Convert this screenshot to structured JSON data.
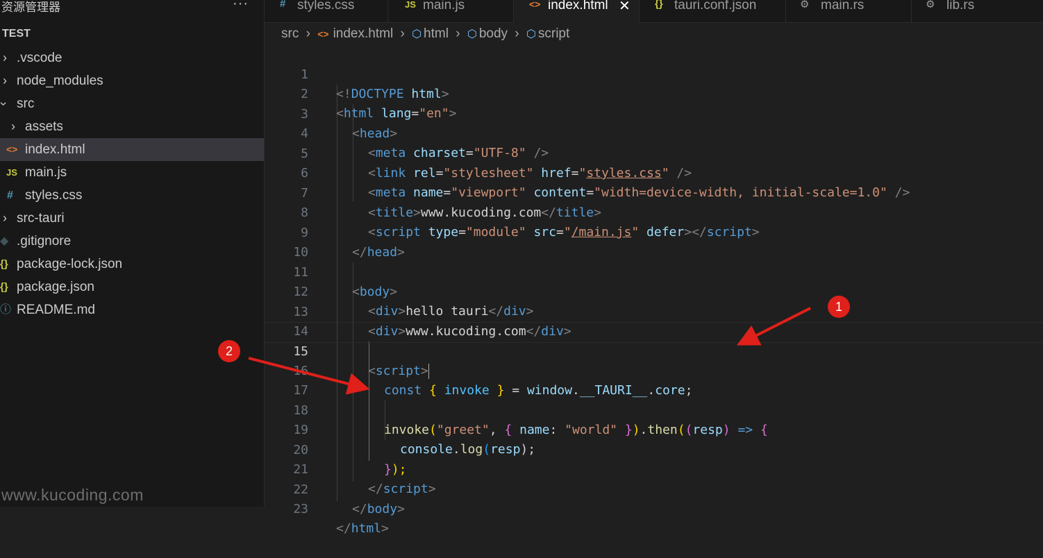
{
  "sidebar": {
    "title": "资源管理器",
    "more": "···",
    "project": "TEST",
    "items": [
      {
        "label": ".vscode",
        "icon": "chevron-right-icon"
      },
      {
        "label": "node_modules",
        "icon": "chevron-right-icon"
      },
      {
        "label": "src",
        "icon": "chevron-down-icon"
      },
      {
        "label": "assets",
        "icon": "chevron-right-icon"
      },
      {
        "label": "index.html",
        "icon": "html-file-icon",
        "glyph": "<>"
      },
      {
        "label": "main.js",
        "icon": "js-file-icon",
        "glyph": "JS"
      },
      {
        "label": "styles.css",
        "icon": "css-file-icon",
        "glyph": "#"
      },
      {
        "label": "src-tauri",
        "icon": "chevron-right-icon"
      },
      {
        "label": ".gitignore",
        "icon": "git-file-icon"
      },
      {
        "label": "package-lock.json",
        "icon": "json-file-icon",
        "glyph": "{}"
      },
      {
        "label": "package.json",
        "icon": "json-file-icon",
        "glyph": "{}"
      },
      {
        "label": "README.md",
        "icon": "info-file-icon",
        "glyph": "ⓘ"
      }
    ],
    "watermark": "www.kucoding.com"
  },
  "tabs": [
    {
      "label": "styles.css",
      "glyph": "#"
    },
    {
      "label": "main.js",
      "glyph": "JS"
    },
    {
      "label": "index.html",
      "glyph": "<>",
      "close": "✕"
    },
    {
      "label": "tauri.conf.json",
      "glyph": "{}"
    },
    {
      "label": "main.rs"
    },
    {
      "label": "lib.rs"
    }
  ],
  "breadcrumb": [
    "src",
    "index.html",
    "html",
    "body",
    "script"
  ],
  "editor": {
    "line_numbers": [
      "1",
      "2",
      "3",
      "4",
      "5",
      "6",
      "7",
      "8",
      "9",
      "10",
      "11",
      "12",
      "13",
      "14",
      "15",
      "16",
      "17",
      "18",
      "19",
      "20",
      "21",
      "22",
      "23"
    ],
    "current_line": "15",
    "code": {
      "l1": [
        "<!",
        "DOCTYPE",
        " html",
        ">"
      ],
      "l2": [
        "<",
        "html",
        " lang",
        "=",
        "\"en\"",
        ">"
      ],
      "l3": [
        "<",
        "head",
        ">"
      ],
      "l4": [
        "<",
        "meta",
        " charset",
        "=",
        "\"UTF-8\"",
        " />"
      ],
      "l5": [
        "<",
        "link",
        " rel",
        "=",
        "\"stylesheet\"",
        " href",
        "=",
        "\"",
        "styles.css",
        "\"",
        " />"
      ],
      "l6": [
        "<",
        "meta",
        " name",
        "=",
        "\"viewport\"",
        " content",
        "=",
        "\"width=device-width, initial-scale=1.0\"",
        " />"
      ],
      "l7": [
        "<",
        "title",
        ">",
        "www.kucoding.com",
        "</",
        "title",
        ">"
      ],
      "l8": [
        "<",
        "script",
        " type",
        "=",
        "\"module\"",
        " src",
        "=",
        "\"",
        "/main.js",
        "\"",
        " defer",
        ">",
        "</",
        "script",
        ">"
      ],
      "l9": [
        "</",
        "head",
        ">"
      ],
      "l11": [
        "<",
        "body",
        ">"
      ],
      "l12": [
        "<",
        "div",
        ">",
        "hello tauri",
        "</",
        "div",
        ">"
      ],
      "l13": [
        "<",
        "div",
        ">",
        "www.kucoding.com",
        "</",
        "div",
        ">"
      ],
      "l15": [
        "<",
        "script",
        ">"
      ],
      "l16": [
        "const",
        " {",
        " invoke",
        " }",
        " = ",
        "window",
        ".",
        "__TAURI__",
        ".",
        "core",
        ";"
      ],
      "l18": [
        "invoke",
        "(",
        "\"greet\"",
        ", ",
        "{",
        " name",
        ": ",
        "\"world\"",
        " }",
        ")",
        ".",
        "then",
        "(",
        "(",
        "resp",
        ")",
        " => ",
        "{"
      ],
      "l19": [
        "console",
        ".",
        "log",
        "(",
        "resp",
        ");"
      ],
      "l20": [
        "}",
        ");"
      ],
      "l21": [
        "</",
        "script",
        ">"
      ],
      "l22": [
        "</",
        "body",
        ">"
      ],
      "l23": [
        "</",
        "html",
        ">"
      ]
    }
  },
  "annotations": [
    {
      "label": "1",
      "color": "#e0201a"
    },
    {
      "label": "2",
      "color": "#e0201a"
    }
  ]
}
